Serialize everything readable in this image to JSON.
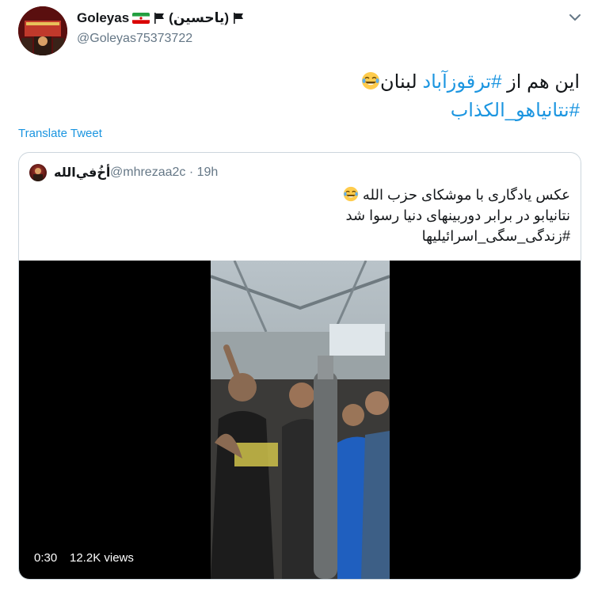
{
  "tweet": {
    "display_name": "Goleyas",
    "name_suffix": "(یاحسین)",
    "handle": "@Goleyas75373722",
    "text_line1_prefix": "این هم از ",
    "text_line1_hashtag": "#ترقوزآباد",
    "text_line1_suffix": " لبنان",
    "text_line2_hashtag": "#نتانیاهو_الکذاب",
    "translate_label": "Translate Tweet"
  },
  "quoted_tweet": {
    "display_name": "أخُ‌في‌الله",
    "handle_time": "@mhrezaa2c · 19h",
    "line1": "عکس یادگاری با موشکای حزب الله",
    "line2": "نتانیابو در برابر دوربینهای دنیا رسوا شد",
    "line3_hashtag": "#زندگی_سگی_اسرائیلیها"
  },
  "video": {
    "duration": "0:30",
    "views": "12.2K views"
  },
  "icons": {
    "more": "chevron-down-icon",
    "emoji": "tears-of-joy-emoji",
    "flag": "iran-flag-icon",
    "black_flag": "black-flag-icon"
  },
  "colors": {
    "link": "#1b95e0",
    "secondary_text": "#657786",
    "border": "#ccd6dd"
  }
}
